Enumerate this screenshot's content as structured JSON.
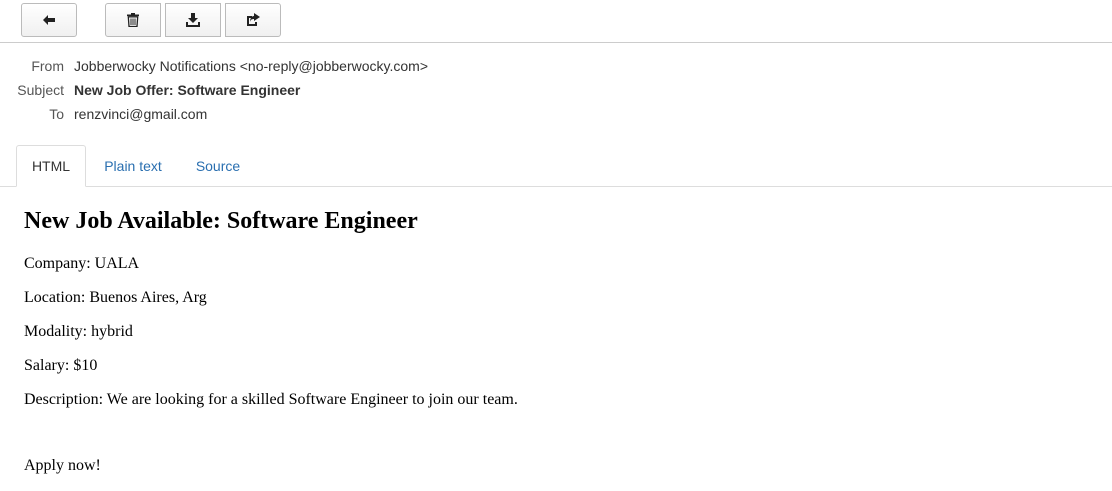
{
  "toolbar": {
    "buttons": [
      {
        "icon": "arrow-left-icon",
        "label": ""
      },
      {
        "icon": "trash-icon",
        "label": ""
      },
      {
        "icon": "download-icon",
        "label": ""
      },
      {
        "icon": "share-icon",
        "label": ""
      }
    ]
  },
  "headers": {
    "from_label": "From",
    "from_value": "Jobberwocky Notifications <no-reply@jobberwocky.com>",
    "subject_label": "Subject",
    "subject_value": "New Job Offer: Software Engineer",
    "to_label": "To",
    "to_value": "renzvinci@gmail.com"
  },
  "tabs": {
    "html": "HTML",
    "plain": "Plain text",
    "source": "Source",
    "active": "HTML"
  },
  "message": {
    "heading": "New Job Available: Software Engineer",
    "company": "Company: UALA",
    "location": "Location: Buenos Aires, Arg",
    "modality": "Modality: hybrid",
    "salary": "Salary: $10",
    "description": "Description: We are looking for a skilled Software Engineer to join our team.",
    "apply": "Apply now!"
  },
  "colors": {
    "link": "#2a6fb0",
    "border": "#cccccc",
    "text": "#333333"
  }
}
